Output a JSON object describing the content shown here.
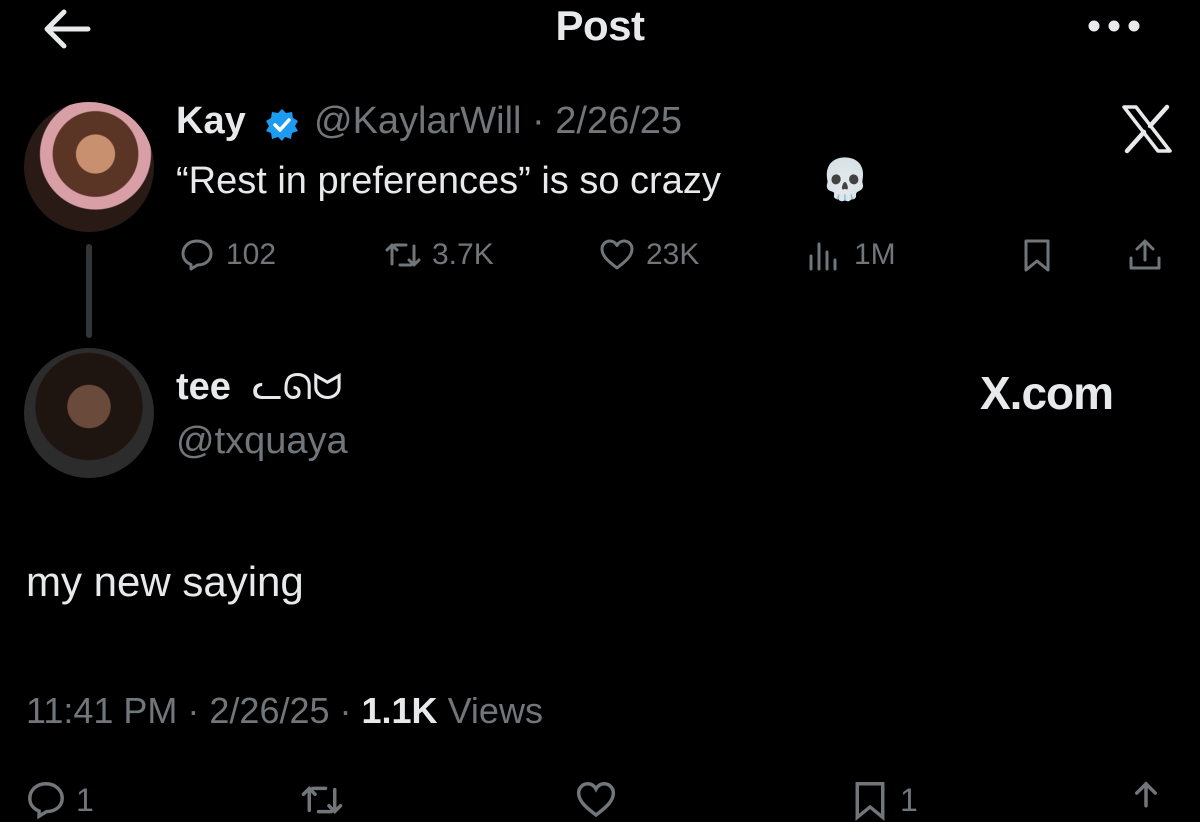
{
  "header": {
    "title": "Post",
    "back_icon": "back-arrow-icon",
    "more_icon": "more-dots-icon"
  },
  "parent_post": {
    "author_name": "Kay",
    "verified_icon": "verified-badge-icon",
    "handle_and_date": "@KaylarWill · 2/26/25",
    "text": "“Rest in preferences” is so crazy",
    "emoji": "💀",
    "metrics": {
      "replies": "102",
      "reposts": "3.7K",
      "likes": "23K",
      "views": "1M"
    }
  },
  "reply_post": {
    "author_name": "tee",
    "name_decoration": "ᓚᘏᗢ",
    "handle": "@txquaya",
    "text": "my new saying",
    "timestamp": "11:41 PM · 2/26/25 · ",
    "views_count": "1.1K",
    "views_label": " Views",
    "bottom_bar": {
      "replies": "1",
      "bookmarks": "1"
    }
  },
  "watermark": {
    "logo_text": "X",
    "site_text": "X.com"
  },
  "colors": {
    "background": "#000000",
    "text": "#e7e9ea",
    "muted": "#71767b",
    "verified": "#1d9bf0"
  }
}
